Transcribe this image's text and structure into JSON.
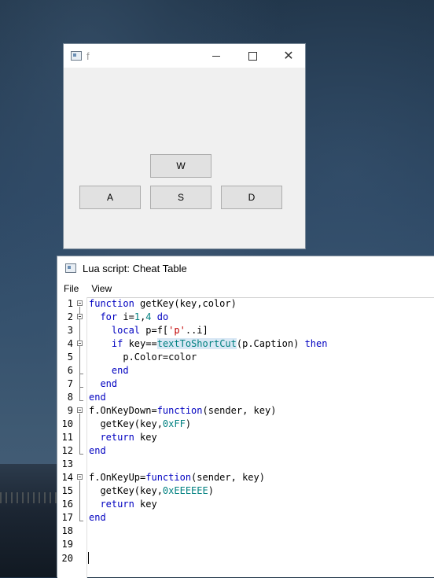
{
  "form": {
    "title": "f",
    "buttons": {
      "w": "W",
      "a": "A",
      "s": "S",
      "d": "D"
    }
  },
  "editor_window": {
    "title": "Lua script: Cheat Table",
    "menu": [
      "File",
      "View"
    ]
  },
  "code": {
    "line_numbers": [
      "1",
      "2",
      "3",
      "4",
      "5",
      "6",
      "7",
      "8",
      "9",
      "10",
      "11",
      "12",
      "13",
      "14",
      "15",
      "16",
      "17",
      "18",
      "19",
      "20"
    ],
    "lines": [
      "function getKey(key,color)",
      "  for i=1,4 do",
      "    local p=f['p'..i]",
      "    if key==textToShortCut(p.Caption) then",
      "      p.Color=color",
      "    end",
      "  end",
      "end",
      "f.OnKeyDown=function(sender, key)",
      "  getKey(key,0xFF)",
      "  return key",
      "end",
      "",
      "f.OnKeyUp=function(sender, key)",
      "  getKey(key,0xEEEEEE)",
      "  return key",
      "end",
      "",
      "",
      ""
    ]
  },
  "colors": {
    "keyword": "#0000c0",
    "string": "#c00000",
    "number": "#008080",
    "window_bg": "#f0f0f0"
  }
}
